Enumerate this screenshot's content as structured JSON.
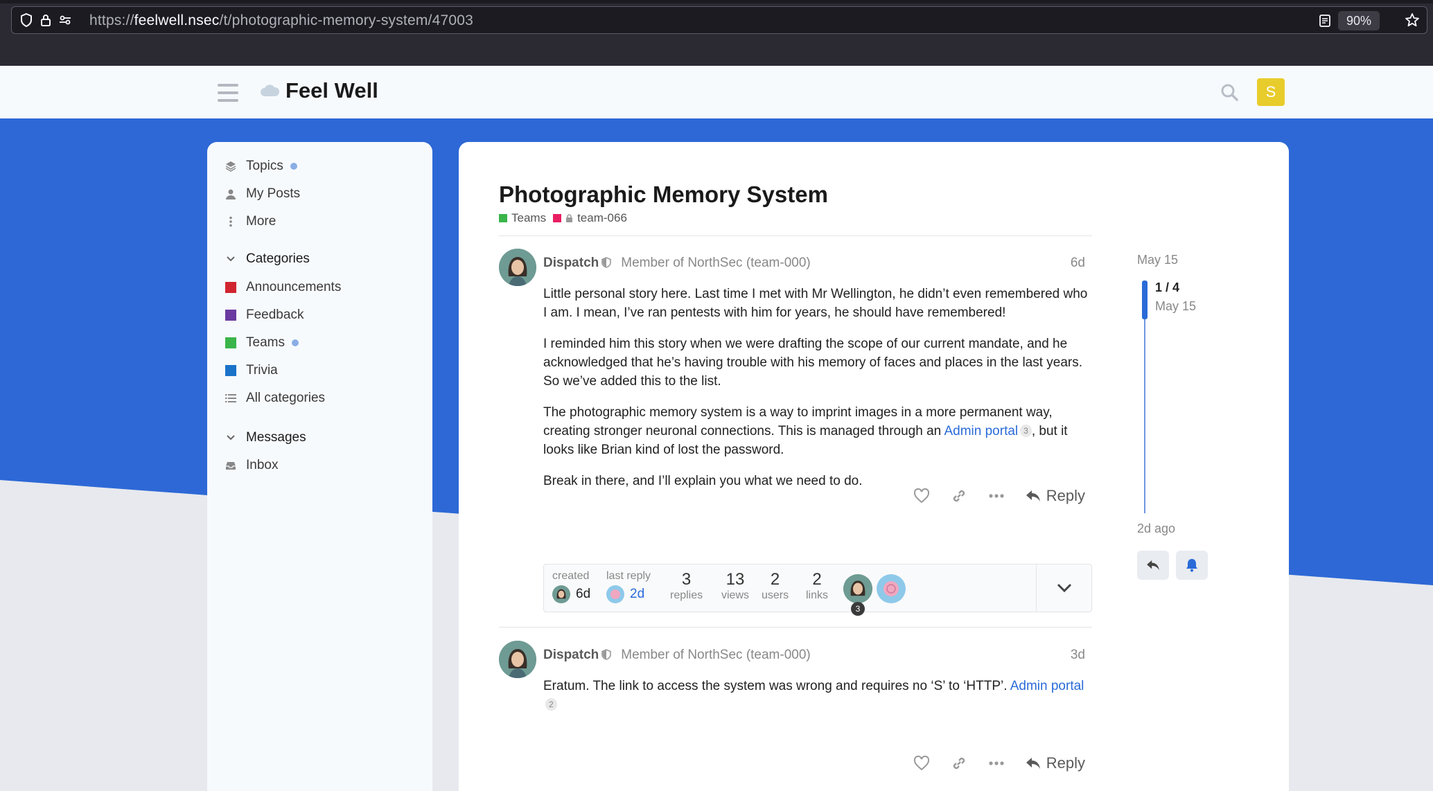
{
  "browser": {
    "url_prefix": "https://",
    "url_host": "feelwell.nsec",
    "url_path": "/t/photographic-memory-system/47003",
    "zoom": "90%"
  },
  "header": {
    "site_title": "Feel Well",
    "user_initial": "S"
  },
  "sidebar": {
    "nav": [
      {
        "label": "Topics",
        "has_dot": true
      },
      {
        "label": "My Posts"
      },
      {
        "label": "More"
      }
    ],
    "categories_heading": "Categories",
    "categories": [
      {
        "label": "Announcements",
        "color": "#d0252f"
      },
      {
        "label": "Feedback",
        "color": "#6b3aa0"
      },
      {
        "label": "Teams",
        "color": "#3ab54a",
        "has_dot": true
      },
      {
        "label": "Trivia",
        "color": "#1a73c9"
      },
      {
        "label": "All categories"
      }
    ],
    "messages_heading": "Messages",
    "messages": [
      {
        "label": "Inbox"
      }
    ]
  },
  "topic": {
    "title": "Photographic Memory System",
    "category": {
      "label": "Teams",
      "color": "#3ab54a"
    },
    "subcategory": {
      "label": "team-066",
      "color": "#e91e63"
    }
  },
  "posts": [
    {
      "username": "Dispatch",
      "flair": "Member of NorthSec (team-000)",
      "age": "6d",
      "paragraphs": [
        "Little personal story here. Last time I met with Mr Wellington, he didn’t even remembered who I am. I mean, I’ve ran pentests with him for years, he should have remembered!",
        "I reminded him this story when we were drafting the scope of our current mandate, and he acknowledged that he’s having trouble with his memory of faces and places in the last years. So we’ve added this to the list."
      ],
      "p3_before": "The photographic memory system is a way to imprint images in a more permanent way, creating stronger neuronal connections. This is managed through an ",
      "p3_link": "Admin portal",
      "p3_link_clicks": "3",
      "p3_after": ", but it looks like Brian kind of lost the password.",
      "p4": "Break in there, and I’ll explain you what we need to do.",
      "reply_label": "Reply"
    },
    {
      "username": "Dispatch",
      "flair": "Member of NorthSec (team-000)",
      "age": "3d",
      "text_before": "Eratum. The link to access the system was wrong and requires no ‘S’ to ‘HTTP’. ",
      "link": "Admin portal",
      "link_clicks": "2",
      "reply_label": "Reply"
    }
  ],
  "topic_map": {
    "created_label": "created",
    "created_value": "6d",
    "last_reply_label": "last reply",
    "last_reply_value": "2d",
    "replies_num": "3",
    "replies_label": "replies",
    "views_num": "13",
    "views_label": "views",
    "users_num": "2",
    "users_label": "users",
    "links_num": "2",
    "links_label": "links",
    "participant_count": "3"
  },
  "timeline": {
    "start_date": "May 15",
    "position": "1 / 4",
    "position_date": "May 15",
    "end_label": "2d ago"
  },
  "icons": {
    "hamburger": "hamburger-icon",
    "search": "search-icon",
    "like": "heart-icon",
    "link": "link-icon",
    "more": "ellipsis-icon",
    "reply": "reply-icon",
    "bell": "bell-icon"
  }
}
